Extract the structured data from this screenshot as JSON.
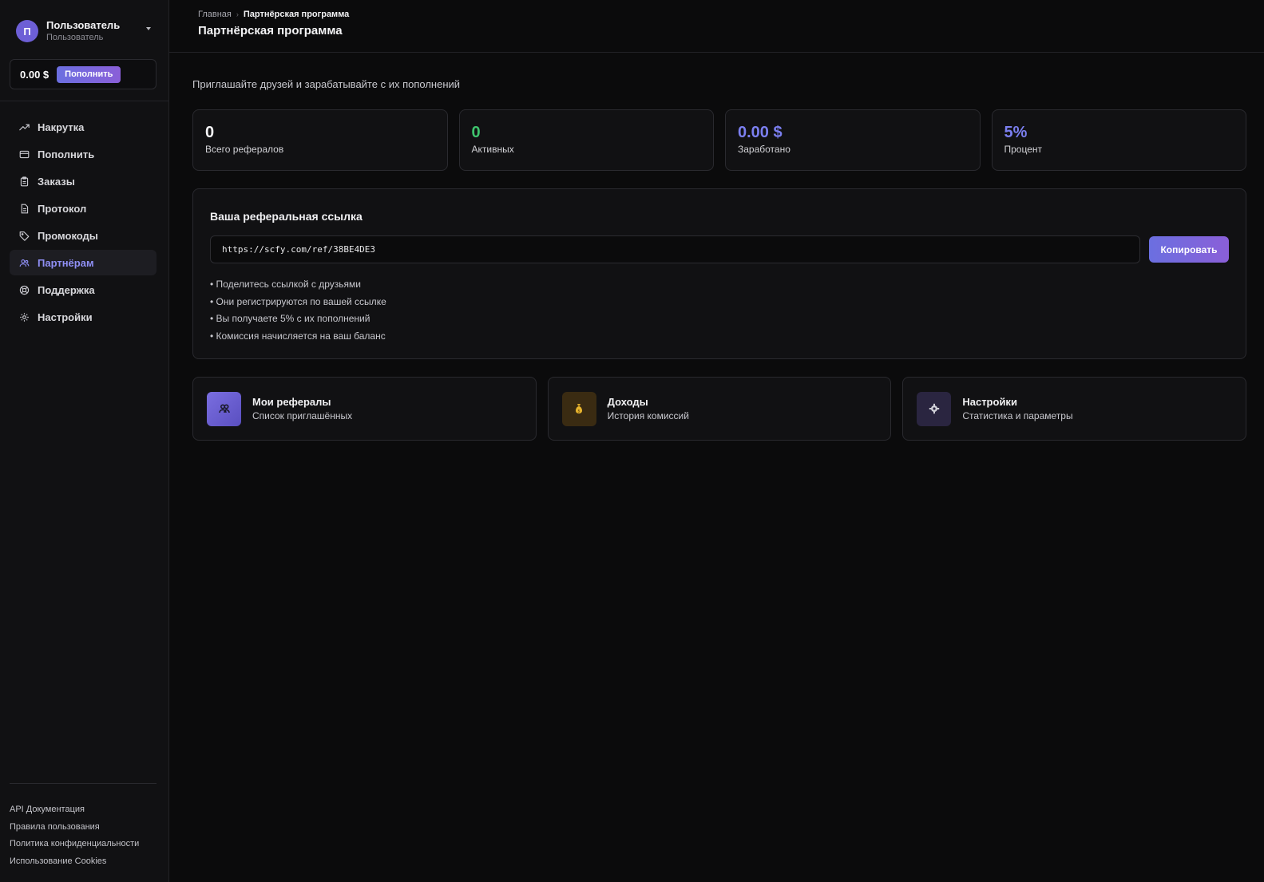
{
  "user": {
    "avatar_letter": "П",
    "name": "Пользователь",
    "role": "Пользователь"
  },
  "balance": {
    "amount": "0.00 $",
    "topup_label": "Пополнить"
  },
  "nav": [
    {
      "label": "Накрутка",
      "icon": "trending-up-icon",
      "active": false
    },
    {
      "label": "Пополнить",
      "icon": "card-icon",
      "active": false
    },
    {
      "label": "Заказы",
      "icon": "clipboard-icon",
      "active": false
    },
    {
      "label": "Протокол",
      "icon": "document-icon",
      "active": false
    },
    {
      "label": "Промокоды",
      "icon": "tag-icon",
      "active": false
    },
    {
      "label": "Партнёрам",
      "icon": "users-icon",
      "active": true
    },
    {
      "label": "Поддержка",
      "icon": "lifebuoy-icon",
      "active": false
    },
    {
      "label": "Настройки",
      "icon": "gear-icon",
      "active": false
    }
  ],
  "footer_links": [
    "API Документация",
    "Правила пользования",
    "Политика конфиденциальности",
    "Использование Cookies"
  ],
  "header": {
    "breadcrumb_home": "Главная",
    "breadcrumb_separator": "›",
    "breadcrumb_current": "Партнёрская программа",
    "title": "Партнёрская программа"
  },
  "subtitle": "Приглашайте друзей и зарабатывайте с их пополнений",
  "stats": [
    {
      "value": "0",
      "label": "Всего рефералов",
      "color": "#f4f4f6"
    },
    {
      "value": "0",
      "label": "Активных",
      "color": "#3ec46d"
    },
    {
      "value": "0.00 $",
      "label": "Заработано",
      "color": "#7b7ff0"
    },
    {
      "value": "5%",
      "label": "Процент",
      "color": "#7b7ff0"
    }
  ],
  "referral": {
    "title": "Ваша реферальная ссылка",
    "link": "https://scfy.com/ref/38BE4DE3",
    "copy_label": "Копировать",
    "bullets": [
      "• Поделитесь ссылкой с друзьями",
      "• Они регистрируются по вашей ссылке",
      "• Вы получаете 5% с их пополнений",
      "• Комиссия начисляется на ваш баланс"
    ]
  },
  "actions": [
    {
      "title": "Мои рефералы",
      "desc": "Список приглашённых",
      "icon": "users-icon",
      "bg": "#6b5fd0"
    },
    {
      "title": "Доходы",
      "desc": "История комиссий",
      "icon": "money-bag-icon",
      "bg": "#3a2b12"
    },
    {
      "title": "Настройки",
      "desc": "Статистика и параметры",
      "icon": "gear-icon",
      "bg": "#2a2540"
    }
  ]
}
